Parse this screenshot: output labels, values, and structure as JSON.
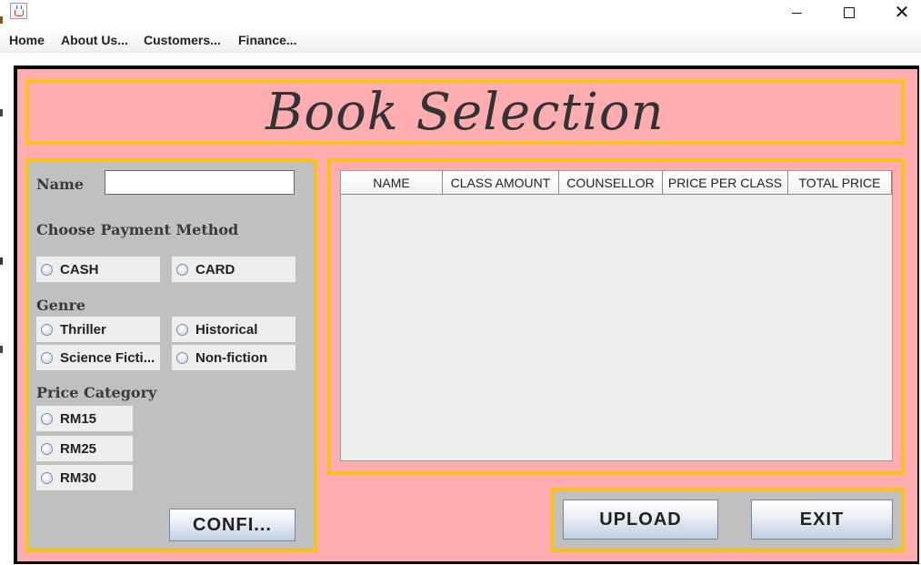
{
  "window": {
    "icon": "java-cup-icon",
    "controls": [
      "minimize-icon",
      "maximize-icon",
      "close-icon"
    ],
    "close_glyph": "✕"
  },
  "menubar": {
    "items": [
      "Home",
      "About Us...",
      "Customers...",
      "Finance..."
    ]
  },
  "title": "Book Selection",
  "form": {
    "name_label": "Name",
    "name_value": "",
    "payment_label": "Choose Payment Method",
    "payment_options": [
      "CASH",
      "CARD"
    ],
    "genre_label": "Genre",
    "genre_options": [
      "Thriller",
      "Historical",
      "Science Ficti...",
      "Non-fiction"
    ],
    "price_label": "Price Category",
    "price_options": [
      "RM15",
      "RM25",
      "RM30"
    ],
    "confirm_button": "CONFI..."
  },
  "table": {
    "columns": [
      "NAME",
      "CLASS AMOUNT",
      "COUNSELLOR",
      "PRICE PER CLASS",
      "TOTAL PRICE"
    ],
    "rows": []
  },
  "actions": {
    "upload_button": "UPLOAD",
    "exit_button": "EXIT"
  },
  "colors": {
    "background_pink": "#ffadb1",
    "border_yellow": "#f7c21a",
    "panel_gray": "#c0c0c0"
  }
}
